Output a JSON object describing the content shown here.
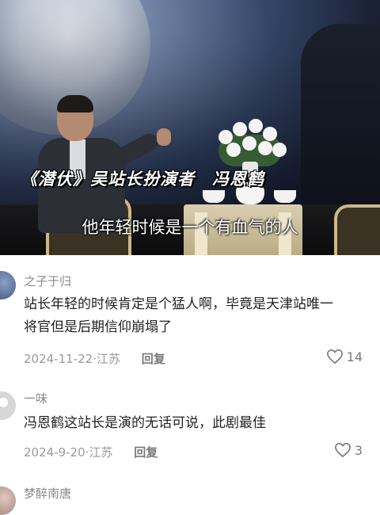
{
  "video": {
    "caption": "《潜伏》吴站长扮演者",
    "actor_name": "冯恩鹤",
    "subtitle": "他年轻时候是一个有血气的人"
  },
  "comments": [
    {
      "username": "之子于归",
      "text_line1": "站长年轻的时候肯定是个猛人啊，毕竟是天津站唯一",
      "text_line2": "将官但是后期信仰崩塌了",
      "date": "2024-11-22",
      "location": "江苏",
      "reply_label": "回复",
      "likes": "14"
    },
    {
      "username": "一味",
      "text_line1": "冯恩鹤这站长是演的无话可说，此剧最佳",
      "date": "2024-9-20",
      "location": "江苏",
      "reply_label": "回复",
      "likes": "3"
    },
    {
      "username": "梦醉南唐"
    }
  ],
  "icons": {
    "like": "heart-outline-icon",
    "avatar": "user-avatar"
  },
  "colors": {
    "meta": "#9a9a9a",
    "username": "#8a8a8a",
    "text": "#222222"
  }
}
